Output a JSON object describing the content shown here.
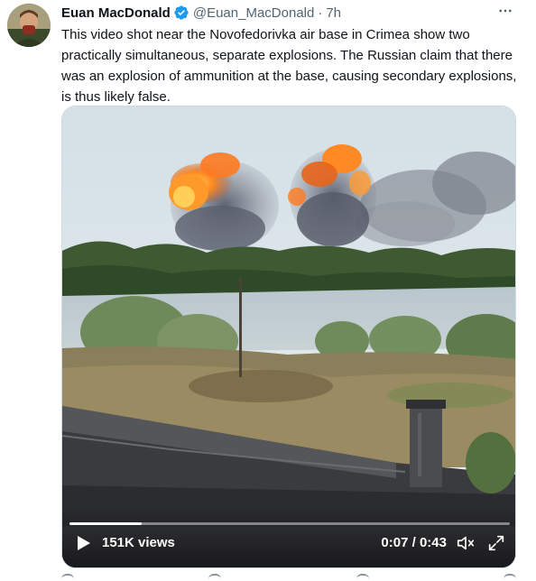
{
  "tweet": {
    "author_name": "Euan MacDonald",
    "handle": "@Euan_MacDonald",
    "separator": "·",
    "time": "7h",
    "more_label": "···",
    "text": "This video shot near the Novofedorivka air base in Crimea show two practically simultaneous, separate explosions. The Russian claim that there was an explosion of ammunition at the base, causing secondary explosions, is thus likely false."
  },
  "video": {
    "views": "151K views",
    "current_time": "0:07",
    "time_separator": "/",
    "duration": "0:43",
    "progress_fraction": 0.163
  },
  "colors": {
    "verified": "#1d9bf0",
    "text": "#0f1419",
    "secondary": "#536471"
  },
  "icons": {
    "verified": "verified-badge-icon",
    "more": "more-options-icon",
    "play": "play-icon",
    "volume": "volume-icon",
    "fullscreen": "fullscreen-icon"
  }
}
